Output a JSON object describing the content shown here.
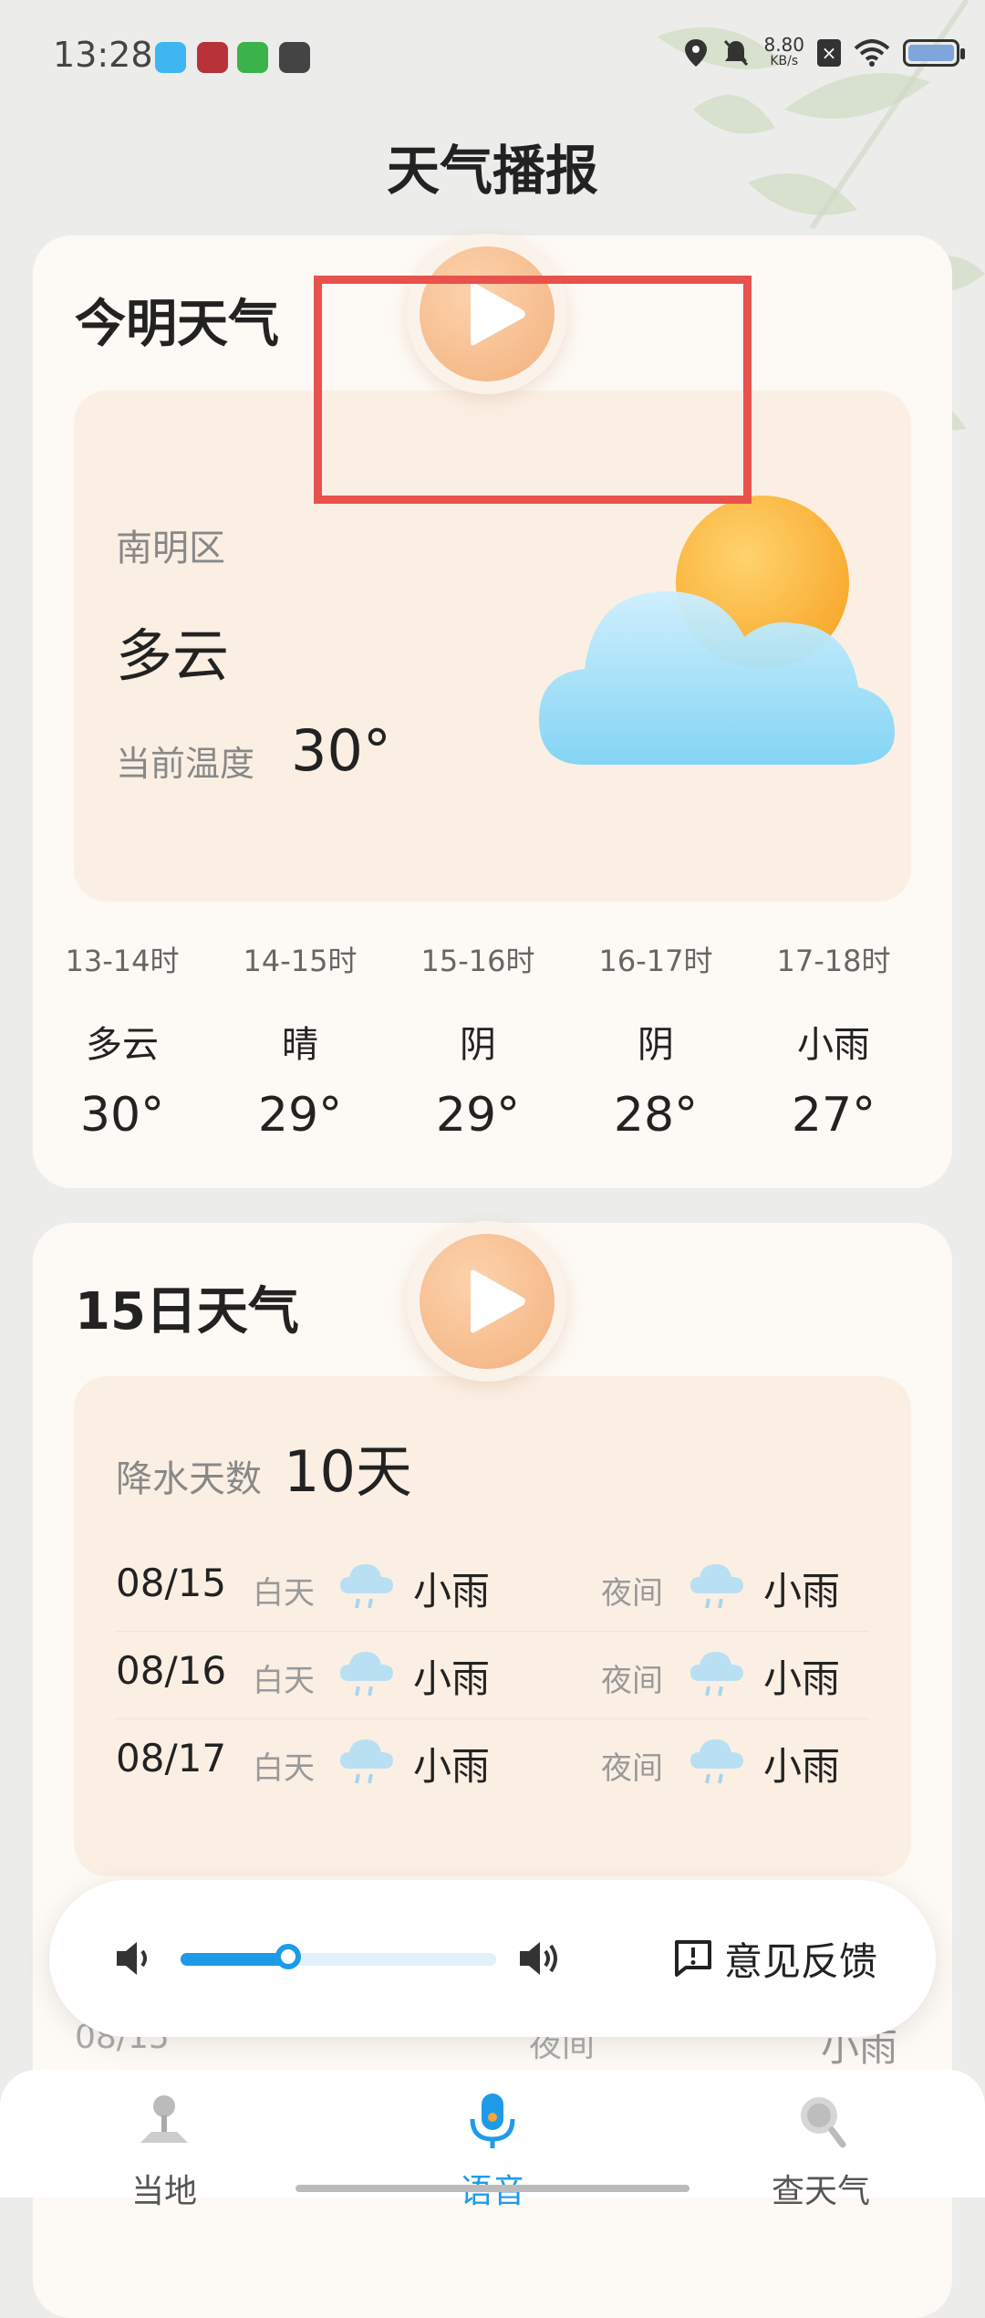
{
  "status_bar": {
    "time": "13:28",
    "net_speed_value": "8.80",
    "net_speed_unit": "KB/s"
  },
  "page_title": "天气播报",
  "today_card": {
    "title": "今明天气",
    "district": "南明区",
    "condition": "多云",
    "current_temp_label": "当前温度",
    "current_temp": "30°",
    "hourly": [
      {
        "range": "13-14时",
        "condition": "多云",
        "temp": "30°"
      },
      {
        "range": "14-15时",
        "condition": "晴",
        "temp": "29°"
      },
      {
        "range": "15-16时",
        "condition": "阴",
        "temp": "29°"
      },
      {
        "range": "16-17时",
        "condition": "阴",
        "temp": "28°"
      },
      {
        "range": "17-18时",
        "condition": "小雨",
        "temp": "27°"
      }
    ]
  },
  "forecast_card": {
    "title": "15日天气",
    "rain_days_label": "降水天数",
    "rain_days_value": "10天",
    "days": [
      {
        "date": "08/15",
        "day_label": "白天",
        "day_weather": "小雨",
        "night_label": "夜间",
        "night_weather": "小雨"
      },
      {
        "date": "08/16",
        "day_label": "白天",
        "day_weather": "小雨",
        "night_label": "夜间",
        "night_weather": "小雨"
      },
      {
        "date": "08/17",
        "day_label": "白天",
        "day_weather": "小雨",
        "night_label": "夜间",
        "night_weather": "小雨"
      }
    ],
    "partial_row": {
      "date": "08/15",
      "night_label": "夜间",
      "weather": "小雨"
    }
  },
  "audio_bar": {
    "volume_level": 0.34,
    "feedback_label": "意见反馈"
  },
  "bottom_nav": [
    {
      "label": "当地",
      "icon": "map-pin-icon",
      "active": false
    },
    {
      "label": "语音",
      "icon": "microphone-icon",
      "active": true
    },
    {
      "label": "查天气",
      "icon": "search-icon",
      "active": false
    }
  ],
  "colors": {
    "accent": "#1e9be8",
    "card_bg": "#fdf9f4",
    "panel_bg": "#fbefe4",
    "play_button": "#f3b17d",
    "highlight_box": "#e8524d"
  }
}
